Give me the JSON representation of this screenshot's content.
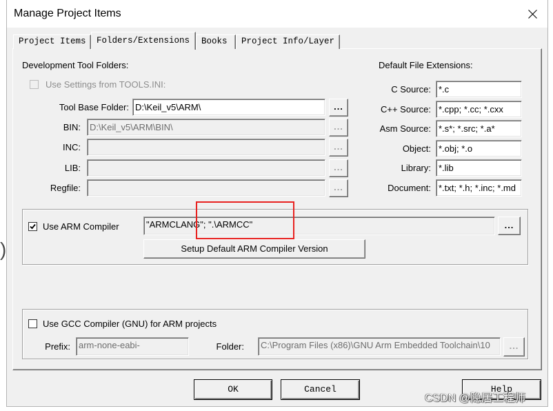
{
  "window": {
    "title": "Manage Project Items",
    "close_icon": "close-icon"
  },
  "tabs": [
    {
      "label": "Project Items",
      "selected": false
    },
    {
      "label": "Folders/Extensions",
      "selected": true
    },
    {
      "label": "Books",
      "selected": false
    },
    {
      "label": "Project Info/Layer",
      "selected": false
    }
  ],
  "folders": {
    "heading": "Development Tool Folders:",
    "use_tools_ini": {
      "label": "Use Settings from TOOLS.INI:",
      "checked": false,
      "enabled": false
    },
    "rows": [
      {
        "label": "Tool Base Folder:",
        "value": "D:\\Keil_v5\\ARM\\",
        "enabled": true,
        "browse": "..."
      },
      {
        "label": "BIN:",
        "value": "D:\\Keil_v5\\ARM\\BIN\\",
        "enabled": false,
        "browse": "..."
      },
      {
        "label": "INC:",
        "value": "",
        "enabled": false,
        "browse": "..."
      },
      {
        "label": "LIB:",
        "value": "",
        "enabled": false,
        "browse": "..."
      },
      {
        "label": "Regfile:",
        "value": "",
        "enabled": false,
        "browse": "..."
      }
    ]
  },
  "extensions": {
    "heading": "Default File Extensions:",
    "rows": [
      {
        "label": "C Source:",
        "value": "*.c"
      },
      {
        "label": "C++ Source:",
        "value": "*.cpp; *.cc; *.cxx"
      },
      {
        "label": "Asm Source:",
        "value": "*.s*; *.src; *.a*"
      },
      {
        "label": "Object:",
        "value": "*.obj; *.o"
      },
      {
        "label": "Library:",
        "value": "*.lib"
      },
      {
        "label": "Document:",
        "value": "*.txt; *.h; *.inc; *.md"
      }
    ]
  },
  "arm_compiler": {
    "label": "Use ARM Compiler",
    "checked": true,
    "value": "\"ARMCLANG\"; \".\\ARMCC\"",
    "browse": "...",
    "setup_button": "Setup Default ARM Compiler Version"
  },
  "gcc_compiler": {
    "label": "Use GCC Compiler (GNU) for ARM projects",
    "checked": false,
    "fields_enabled": false,
    "prefix_label": "Prefix:",
    "prefix_value": "arm-none-eabi-",
    "folder_label": "Folder:",
    "folder_value": "C:\\Program Files (x86)\\GNU Arm Embedded Toolchain\\10",
    "browse": "..."
  },
  "buttons": {
    "ok": "OK",
    "cancel": "Cancel",
    "help": "Help"
  },
  "annotation": {
    "color": "#e8211f"
  },
  "watermark": "CSDN @隐居工程师",
  "background_fragment": ")"
}
